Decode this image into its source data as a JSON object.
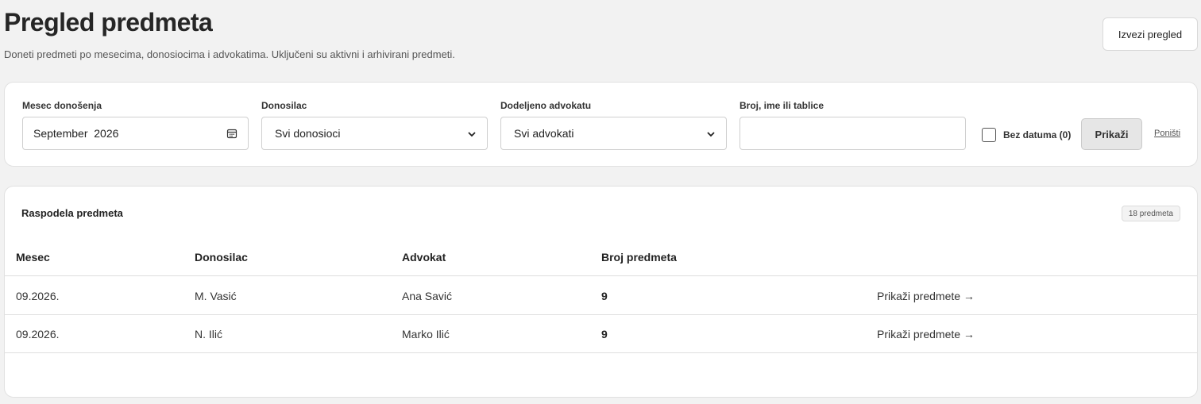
{
  "header": {
    "title": "Pregled predmeta",
    "subtitle": "Doneti predmeti po mesecima, donosiocima i advokatima. Uključeni su aktivni i arhivirani predmeti.",
    "export_label": "Izvezi pregled"
  },
  "filters": {
    "month": {
      "label": "Mesec donošenja",
      "value": "September  2026",
      "icon": "calendar-icon"
    },
    "submitter": {
      "label": "Donosilac",
      "value": "Svi donosioci"
    },
    "lawyer": {
      "label": "Dodeljeno advokatu",
      "value": "Svi advokati"
    },
    "search": {
      "label": "Broj, ime ili tablice",
      "value": ""
    },
    "no_date": {
      "label": "Bez datuma (0)",
      "checked": false
    },
    "show_label": "Prikaži",
    "reset_label": "Poništi"
  },
  "table": {
    "title": "Raspodela predmeta",
    "count_badge": "18 predmeta",
    "columns": [
      "Mesec",
      "Donosilac",
      "Advokat",
      "Broj predmeta",
      ""
    ],
    "rows": [
      {
        "month": "09.2026.",
        "submitter": "M. Vasić",
        "lawyer": "Ana Savić",
        "count": "9",
        "action": "Prikaži predmete →"
      },
      {
        "month": "09.2026.",
        "submitter": "N. Ilić",
        "lawyer": "Marko Ilić",
        "count": "9",
        "action": "Prikaži predmete →"
      }
    ]
  }
}
